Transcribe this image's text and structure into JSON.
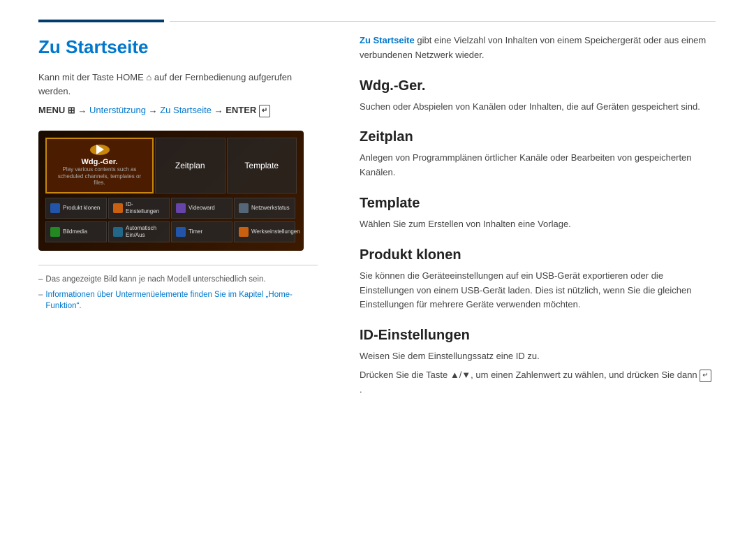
{
  "topBar": {
    "leftBarColor": "#003c6e",
    "rightBarColor": "#cccccc"
  },
  "leftColumn": {
    "title": "Zu Startseite",
    "introText": "Kann mit der Taste HOME ⌂ auf der Fernbedienung aufgerufen werden.",
    "menuPath": {
      "prefix": "MENU ",
      "menu_icon": "≡≡≡",
      "arrow1": " → ",
      "link1": "Unterstützung",
      "arrow2": " → ",
      "link2": "Zu Startseite",
      "arrow3": " → ",
      "suffix": "ENTER"
    },
    "tvMockup": {
      "mainItem": {
        "title": "Wdg.-Ger.",
        "subtitle": "Play various contents such as scheduled channels, templates or files."
      },
      "secondaryItems": [
        "Zeitplan",
        "Template"
      ],
      "bottomItems": [
        {
          "label": "Produkt klonen",
          "iconClass": "icon-blue"
        },
        {
          "label": "ID-Einstellungen",
          "iconClass": "icon-orange"
        },
        {
          "label": "Videoward",
          "iconClass": "icon-purple"
        },
        {
          "label": "Netzwerkstatus",
          "iconClass": "icon-gray"
        },
        {
          "label": "Bildmedia",
          "iconClass": "icon-green"
        },
        {
          "label": "Automatisch Ein/Aus",
          "iconClass": "icon-teal"
        },
        {
          "label": "Timer",
          "iconClass": "icon-blue"
        },
        {
          "label": "Werkseinstellungen",
          "iconClass": "icon-orange"
        }
      ]
    },
    "notes": [
      "Das angezeigte Bild kann je nach Modell unterschiedlich sein.",
      "Informationen über Untermenüelemente finden Sie im Kapitel „Home-Funktion“."
    ]
  },
  "rightColumn": {
    "introText": {
      "linkText": "Zu Startseite",
      "rest": " gibt eine Vielzahl von Inhalten von einem Speichergerät oder aus einem verbundenen Netzwerk wieder."
    },
    "sections": [
      {
        "id": "wdg-ger",
        "heading": "Wdg.-Ger.",
        "text": "Suchen oder Abspielen von Kanälen oder Inhalten, die auf Geräten gespeichert sind."
      },
      {
        "id": "zeitplan",
        "heading": "Zeitplan",
        "text": "Anlegen von Programmplänen örtlicher Kanäle oder Bearbeiten von gespeicherten Kanälen."
      },
      {
        "id": "template",
        "heading": "Template",
        "text": "Wählen Sie zum Erstellen von Inhalten eine Vorlage."
      },
      {
        "id": "produkt-klonen",
        "heading": "Produkt klonen",
        "text": "Sie können die Geräteeinstellungen auf ein USB-Gerät exportieren oder die Einstellungen von einem USB-Gerät laden. Dies ist nützlich, wenn Sie die gleichen Einstellungen für mehrere Geräte verwenden möchten."
      },
      {
        "id": "id-einstellungen",
        "heading": "ID-Einstellungen",
        "text1": "Weisen Sie dem Einstellungssatz eine ID zu.",
        "text2": "Drücken Sie die Taste ▲/▼, um einen Zahlenwert zu wählen, und drücken Sie dann"
      }
    ]
  }
}
